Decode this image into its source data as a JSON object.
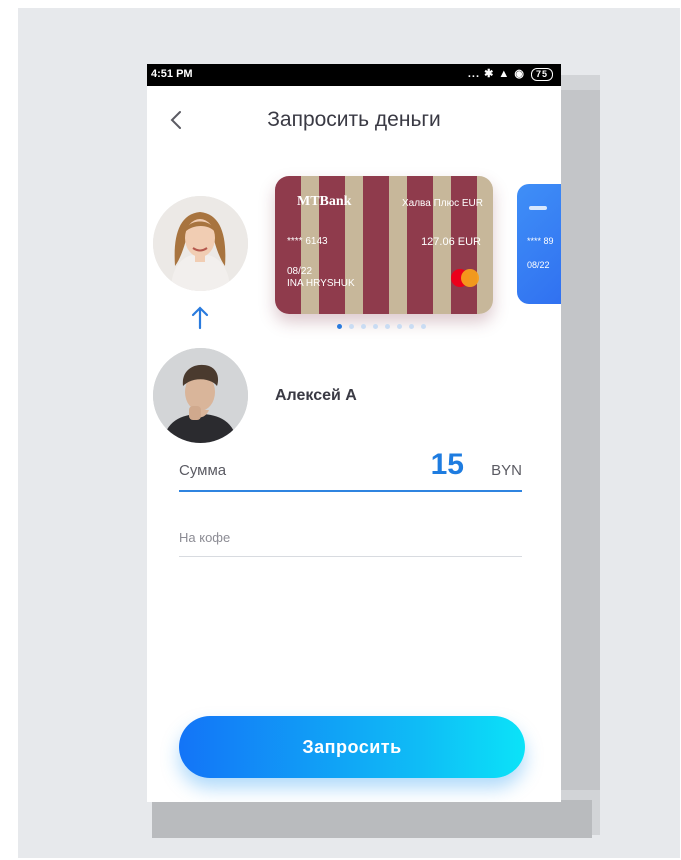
{
  "status_bar": {
    "time": "4:51 PM",
    "signal_icons": "... ✱ ▲ ◉",
    "battery": "75"
  },
  "header": {
    "title": "Запросить деньги",
    "back_icon": "chevron-left-icon"
  },
  "cards": [
    {
      "bank_name": "MTBank",
      "product": "Халва Плюс EUR",
      "masked_number": "**** 6143",
      "balance": "127.06 EUR",
      "expiry": "08/22",
      "holder": "INA HRYSHUK",
      "network_icon": "mastercard-icon",
      "colors": {
        "primary": "#8f3b4c",
        "stripe": "#c7b79a"
      }
    },
    {
      "masked_number": "**** 89",
      "expiry": "08/22",
      "colors": {
        "primary": "#3f8ff7"
      }
    }
  ],
  "carousel": {
    "total_pages": 8,
    "active_page": 0
  },
  "recipient": {
    "name": "Алексей А"
  },
  "amount": {
    "label": "Сумма",
    "value": "15",
    "currency": "BYN"
  },
  "comment": {
    "placeholder": "На кофе"
  },
  "submit_button": {
    "label": "Запросить"
  },
  "accent_color": "#1e7ce0"
}
